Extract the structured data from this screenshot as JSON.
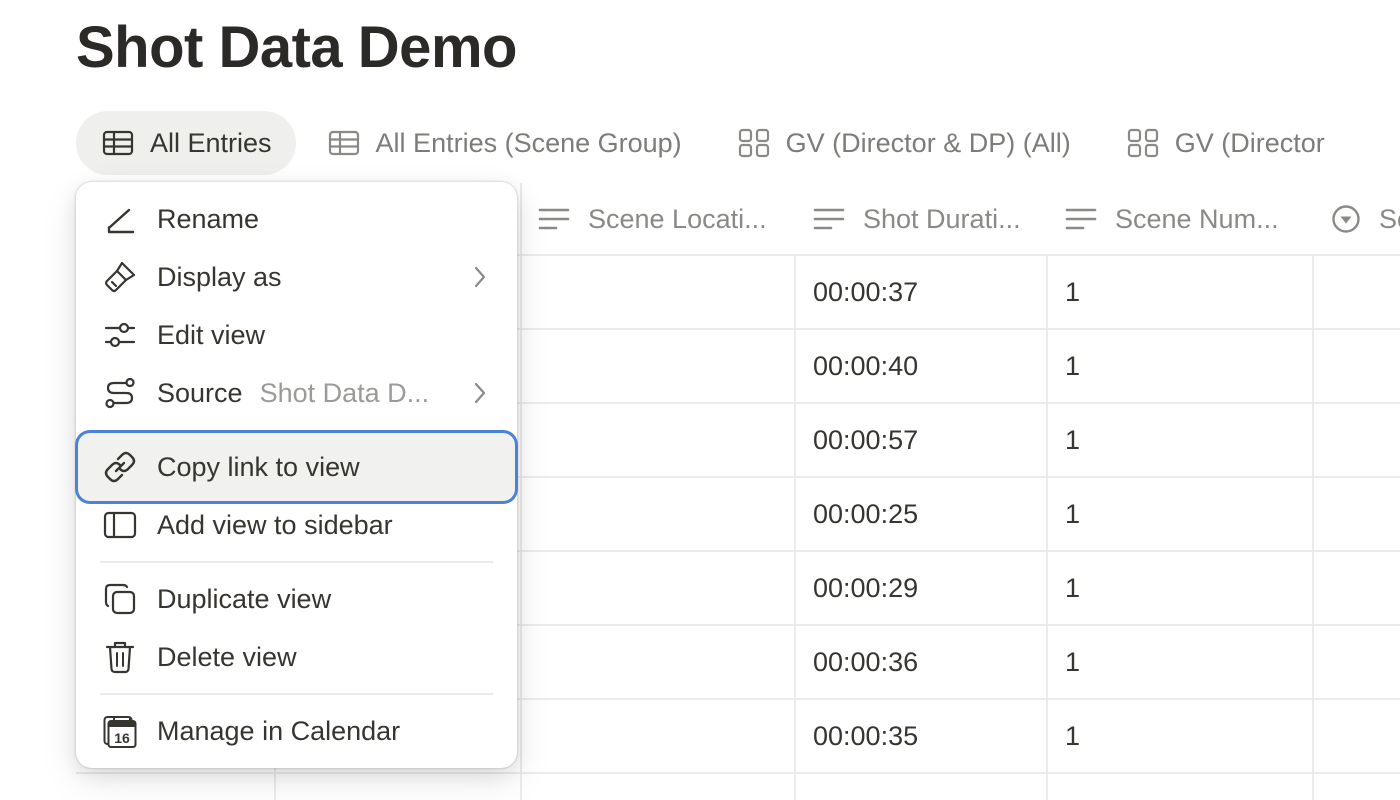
{
  "page": {
    "title": "Shot Data Demo"
  },
  "tabs": [
    {
      "label": "All Entries",
      "icon": "table-icon",
      "active": true
    },
    {
      "label": "All Entries (Scene Group)",
      "icon": "table-icon",
      "active": false
    },
    {
      "label": "GV (Director & DP) (All)",
      "icon": "gallery-icon",
      "active": false
    },
    {
      "label": "GV (Director",
      "icon": "gallery-icon",
      "active": false
    }
  ],
  "table": {
    "columns": [
      {
        "label": "Scene Locati...",
        "icon": "text-property-icon"
      },
      {
        "label": "Shot Durati...",
        "icon": "text-property-icon"
      },
      {
        "label": "Scene Num...",
        "icon": "text-property-icon"
      },
      {
        "label": "Sc",
        "icon": "status-property-icon"
      }
    ],
    "rows": [
      {
        "duration": "00:00:37",
        "scene_number": "1"
      },
      {
        "duration": "00:00:40",
        "scene_number": "1"
      },
      {
        "duration": "00:00:57",
        "scene_number": "1"
      },
      {
        "duration": "00:00:25",
        "scene_number": "1"
      },
      {
        "duration": "00:00:29",
        "scene_number": "1"
      },
      {
        "duration": "00:00:36",
        "scene_number": "1"
      },
      {
        "duration": "00:00:35",
        "scene_number": "1"
      }
    ]
  },
  "context_menu": {
    "items": [
      {
        "label": "Rename",
        "icon": "pencil-icon"
      },
      {
        "label": "Display as",
        "icon": "paintbrush-icon",
        "has_submenu": true
      },
      {
        "label": "Edit view",
        "icon": "sliders-icon"
      },
      {
        "label": "Source",
        "icon": "source-icon",
        "sub": "Shot Data D...",
        "has_submenu": true
      },
      {
        "label": "Copy link to view",
        "icon": "link-icon",
        "focused": true
      },
      {
        "label": "Add view to sidebar",
        "icon": "sidebar-icon"
      },
      {
        "label": "Duplicate view",
        "icon": "duplicate-icon"
      },
      {
        "label": "Delete view",
        "icon": "trash-icon"
      },
      {
        "label": "Manage in Calendar",
        "icon": "calendar-icon"
      }
    ],
    "calendar_icon_day": "16"
  },
  "colors": {
    "accent_focus": "#4a82d6",
    "active_tab_bg": "#efefee",
    "text": "#37352f",
    "muted": "#9b9a97"
  }
}
